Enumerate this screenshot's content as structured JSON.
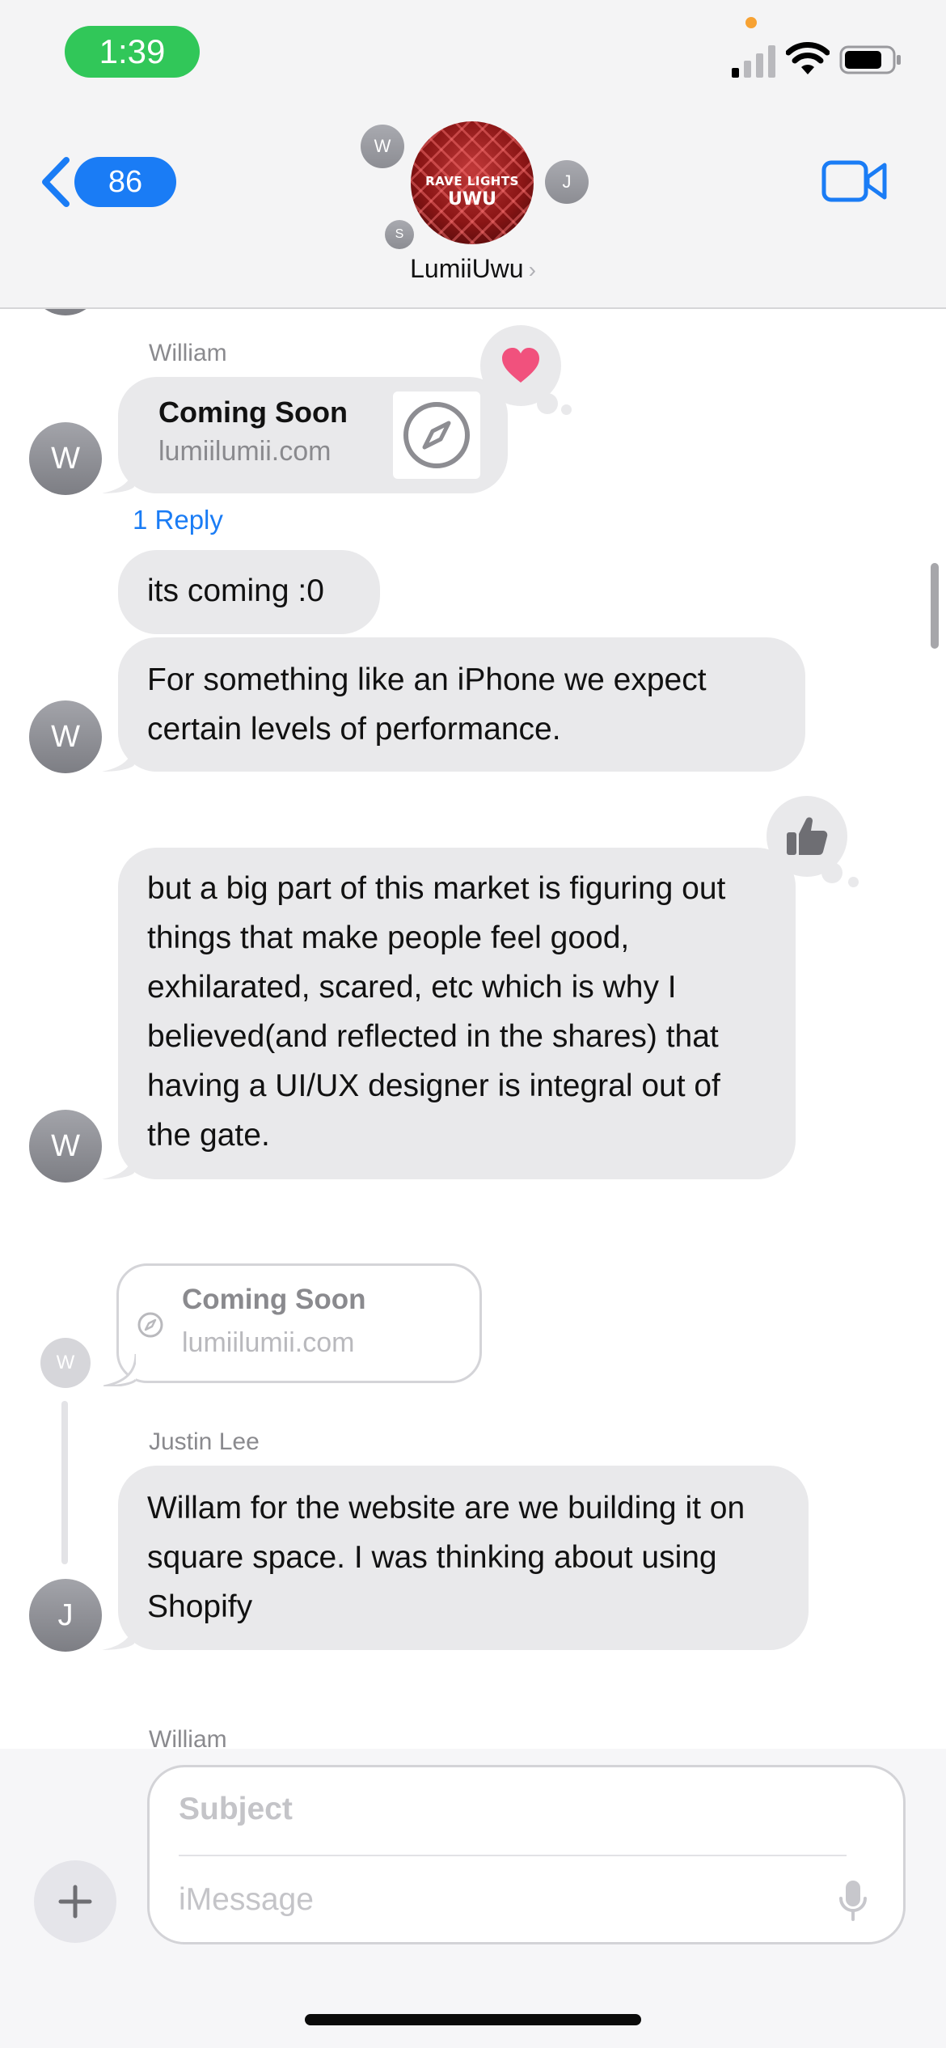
{
  "status_bar": {
    "time": "1:39",
    "accent_time_pill": "#31c759",
    "privacy_dot_color": "#f7a233",
    "icons": [
      "signal-icon",
      "wifi-icon",
      "battery-icon"
    ]
  },
  "header": {
    "back_count": "86",
    "group_name": "LumiiUwu",
    "group_chevron": "›",
    "avatar_text_top": "RAVE LIGHTS",
    "avatar_text_bottom": "UWU",
    "member_initials": [
      "W",
      "J",
      "S"
    ],
    "accent_color": "#1a7cf5",
    "video_icon": "video-camera-icon"
  },
  "messages": [
    {
      "sender": "William",
      "link_title": "Coming Soon",
      "link_domain": "lumiilumii.com",
      "link_icon": "safari-compass-icon",
      "reaction": "heart",
      "reply_label": "1 Reply",
      "avatar": "W"
    },
    {
      "text": "its coming :0"
    },
    {
      "text": "For something like an iPhone we expect certain levels of performance.",
      "avatar": "W"
    },
    {
      "text": "but a big part of this market is figuring out things that make people feel good, exhilarated, scared, etc which is why I believed(and reflected in the shares) that having a UI/UX designer is integral out of the gate.",
      "reaction": "thumbs-up",
      "avatar": "W"
    },
    {
      "quoted_title": "Coming Soon",
      "quoted_domain": "lumiilumii.com",
      "quoted_avatar": "W"
    },
    {
      "sender": "Justin Lee",
      "text": "Willam for the website are we building it on square space. I was thinking about using Shopify",
      "avatar": "J"
    },
    {
      "sender": "William"
    }
  ],
  "compose": {
    "subject_placeholder": "Subject",
    "message_placeholder": "iMessage",
    "plus_label": "+",
    "mic_icon": "microphone-icon"
  }
}
